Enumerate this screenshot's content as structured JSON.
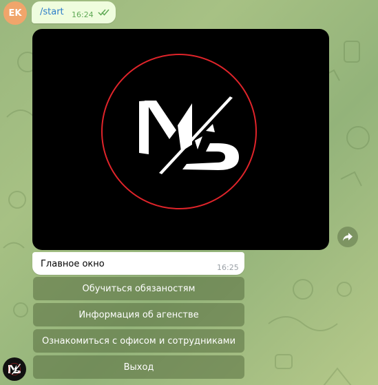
{
  "user": {
    "avatar_initials": "EK"
  },
  "outgoing_message": {
    "text": "/start",
    "time": "16:24",
    "status": "read"
  },
  "bot_message": {
    "logo": "MS",
    "caption": "Главное окно",
    "time": "16:25"
  },
  "keyboard": {
    "buttons": [
      "Обучиться обязаностям",
      "Информация об агенстве",
      "Ознакомиться с офисом и сотрудниками",
      "Выход"
    ]
  },
  "icons": {
    "ticks": "double-check-icon",
    "share": "share-arrow-icon"
  },
  "colors": {
    "outgoing_bubble": "#effdde",
    "command_link": "#2b7cc9",
    "logo_ring": "#e0242a"
  }
}
